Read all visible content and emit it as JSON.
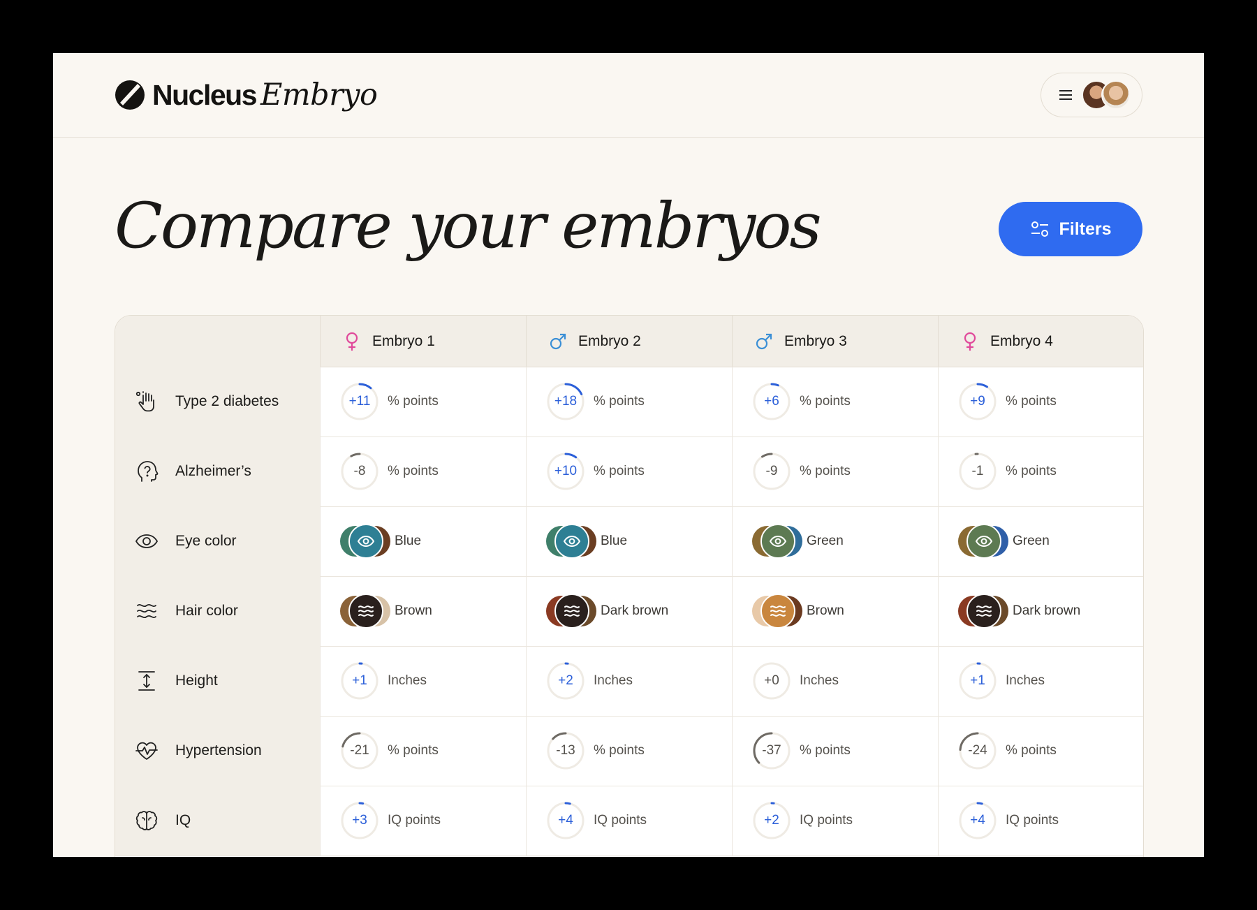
{
  "brand": {
    "name": "Nucleus",
    "product": "Embryo"
  },
  "header": {
    "menu_icon": "hamburger-icon"
  },
  "page": {
    "title": "Compare your embryos",
    "filters_label": "Filters"
  },
  "colors": {
    "accent": "#2f6bf0",
    "positive": "#2b5fd9",
    "female": "#e0489a",
    "male": "#3b8fd6"
  },
  "columns": [
    {
      "label": "Embryo 1",
      "sex": "female"
    },
    {
      "label": "Embryo 2",
      "sex": "male"
    },
    {
      "label": "Embryo 3",
      "sex": "male"
    },
    {
      "label": "Embryo 4",
      "sex": "female"
    }
  ],
  "rows": [
    {
      "label": "Type 2 diabetes",
      "icon": "hand-dots-icon",
      "kind": "gauge",
      "cells": [
        {
          "value": "+11",
          "unit": "% points"
        },
        {
          "value": "+18",
          "unit": "% points"
        },
        {
          "value": "+6",
          "unit": "% points"
        },
        {
          "value": "+9",
          "unit": "% points"
        }
      ]
    },
    {
      "label": "Alzheimer’s",
      "icon": "head-question-icon",
      "kind": "gauge",
      "cells": [
        {
          "value": "-8",
          "unit": "% points"
        },
        {
          "value": "+10",
          "unit": "% points"
        },
        {
          "value": "-9",
          "unit": "% points"
        },
        {
          "value": "-1",
          "unit": "% points"
        }
      ]
    },
    {
      "label": "Eye color",
      "icon": "eye-icon",
      "kind": "trait",
      "cells": [
        {
          "value": "Blue",
          "color": "#2e7f94",
          "left": "#3f7f6a",
          "right": "#6b3e22"
        },
        {
          "value": "Blue",
          "color": "#2e7f94",
          "left": "#3f7f6a",
          "right": "#6b3e22"
        },
        {
          "value": "Green",
          "color": "#5d7a52",
          "left": "#8a6a32",
          "right": "#2f6d9a"
        },
        {
          "value": "Green",
          "color": "#5d7a52",
          "left": "#8a6a32",
          "right": "#2f5fa8"
        }
      ]
    },
    {
      "label": "Hair color",
      "icon": "waves-icon",
      "kind": "trait",
      "cells": [
        {
          "value": "Brown",
          "color": "#2a201d",
          "left": "#8a6238",
          "right": "#d7c2a7"
        },
        {
          "value": "Dark brown",
          "color": "#2a201d",
          "left": "#8a3a22",
          "right": "#6b4a2a"
        },
        {
          "value": "Brown",
          "color": "#c9863e",
          "left": "#e8c9a8",
          "right": "#6b3a20"
        },
        {
          "value": "Dark brown",
          "color": "#2a201d",
          "left": "#8a3a22",
          "right": "#6b4a2a"
        }
      ]
    },
    {
      "label": "Height",
      "icon": "height-icon",
      "kind": "gauge",
      "cells": [
        {
          "value": "+1",
          "unit": "Inches"
        },
        {
          "value": "+2",
          "unit": "Inches"
        },
        {
          "value": "+0",
          "unit": "Inches"
        },
        {
          "value": "+1",
          "unit": "Inches"
        }
      ]
    },
    {
      "label": "Hypertension",
      "icon": "heart-pulse-icon",
      "kind": "gauge",
      "cells": [
        {
          "value": "-21",
          "unit": "% points"
        },
        {
          "value": "-13",
          "unit": "% points"
        },
        {
          "value": "-37",
          "unit": "% points"
        },
        {
          "value": "-24",
          "unit": "% points"
        }
      ]
    },
    {
      "label": "IQ",
      "icon": "brain-icon",
      "kind": "gauge",
      "cells": [
        {
          "value": "+3",
          "unit": "IQ points"
        },
        {
          "value": "+4",
          "unit": "IQ points"
        },
        {
          "value": "+2",
          "unit": "IQ points"
        },
        {
          "value": "+4",
          "unit": "IQ points"
        }
      ]
    }
  ]
}
